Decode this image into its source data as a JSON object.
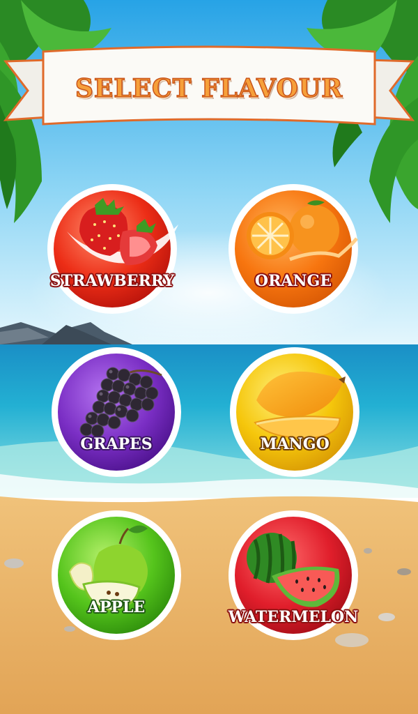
{
  "header": {
    "title": "SELECT FLAVOUR"
  },
  "flavours": [
    {
      "label": "STRAWBERRY",
      "icon": "strawberry-icon",
      "color": "#e8321c"
    },
    {
      "label": "ORANGE",
      "icon": "orange-icon",
      "color": "#f57a10"
    },
    {
      "label": "GRAPES",
      "icon": "grapes-icon",
      "color": "#7b2fc4"
    },
    {
      "label": "MANGO",
      "icon": "mango-icon",
      "color": "#f2c40d"
    },
    {
      "label": "APPLE",
      "icon": "apple-icon",
      "color": "#55c41c"
    },
    {
      "label": "WATERMELON",
      "icon": "watermelon-icon",
      "color": "#e01e2b"
    }
  ],
  "colors": {
    "sky": "#3fb3ec",
    "sea": "#21a6c9",
    "sand": "#e8b96a",
    "banner_text": "#f6a03a"
  }
}
